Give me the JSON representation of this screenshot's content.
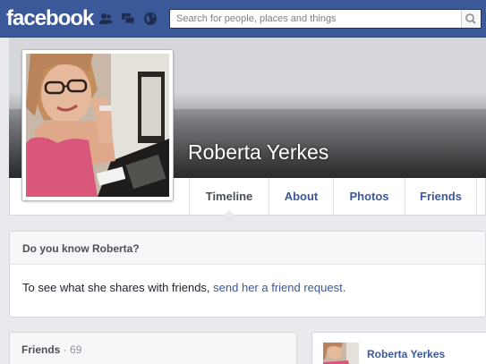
{
  "header": {
    "logo": "facebook",
    "search_placeholder": "Search for people, places and things",
    "brand_color": "#3b5998",
    "icons": [
      "friends-icon",
      "messages-icon",
      "globe-icon",
      "search-icon"
    ]
  },
  "profile": {
    "name": "Roberta Yerkes"
  },
  "nav": {
    "tabs": [
      {
        "label": "Timeline",
        "active": true
      },
      {
        "label": "About",
        "active": false
      },
      {
        "label": "Photos",
        "active": false
      },
      {
        "label": "Friends",
        "active": false
      }
    ]
  },
  "know_box": {
    "title": "Do you know Roberta?",
    "text": "To see what she shares with friends, ",
    "link": "send her a friend request."
  },
  "friends_box": {
    "title": "Friends",
    "count": "· 69"
  },
  "post_card": {
    "name": "Roberta Yerkes"
  }
}
